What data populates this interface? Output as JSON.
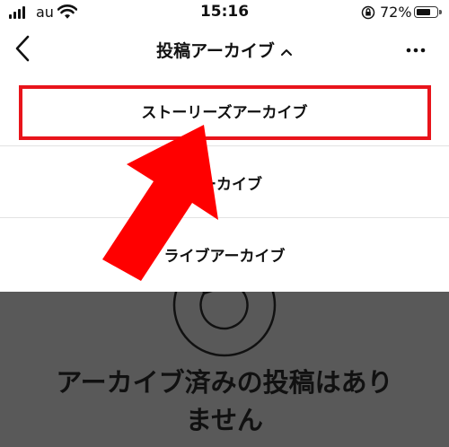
{
  "status_bar": {
    "carrier": "au",
    "time": "15:16",
    "battery_percent": "72%",
    "battery_level": 0.72,
    "icons": [
      "signal-icon",
      "wifi-icon",
      "orientation-lock-icon",
      "battery-icon"
    ]
  },
  "nav": {
    "title": "投稿アーカイブ",
    "title_icon": "chevron-up-icon",
    "back_icon": "back-arrow-icon",
    "more_icon": "more-icon"
  },
  "menu": {
    "items": [
      {
        "label": "ストーリーズアーカイブ"
      },
      {
        "label": "アーカイブ"
      },
      {
        "label": "ライブアーカイブ"
      }
    ]
  },
  "empty_state": {
    "message_line1": "アーカイブ済みの投稿はあり",
    "message_line2": "ません",
    "icon": "archive-icon"
  },
  "annotation": {
    "highlight_color": "#e8141b",
    "arrow_color": "#ff0000"
  }
}
